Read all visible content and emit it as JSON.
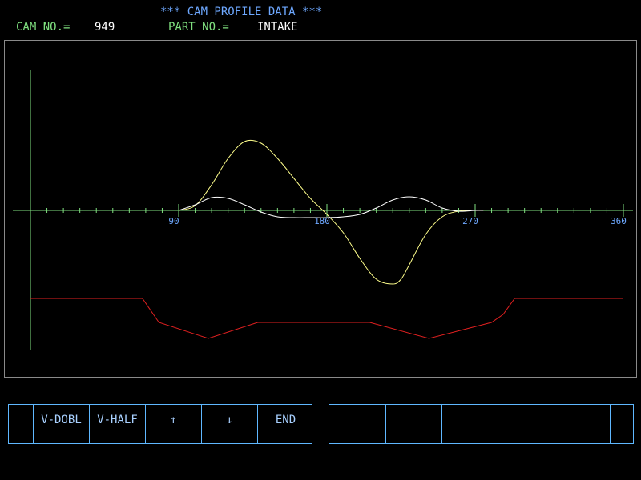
{
  "header": {
    "title": "*** CAM PROFILE DATA ***",
    "cam_no_label": "CAM NO.=",
    "cam_no_value": "949",
    "part_no_label": "PART NO.=",
    "part_no_value": "INTAKE"
  },
  "chart_data": {
    "type": "line",
    "x_range": [
      0,
      360
    ],
    "x_tick_labels": [
      "90",
      "180",
      "270",
      "360"
    ],
    "x_tick_values": [
      90,
      180,
      270,
      360
    ],
    "series": [
      {
        "color": "#ffff8c",
        "x": [
          90,
          100,
          110,
          120,
          130,
          140,
          150,
          160,
          170,
          180,
          190,
          200,
          210,
          220,
          225,
          230,
          240,
          250,
          260,
          270,
          275
        ],
        "y": [
          0,
          0.06,
          0.32,
          0.65,
          0.86,
          0.84,
          0.65,
          0.4,
          0.15,
          -0.05,
          -0.28,
          -0.6,
          -0.86,
          -0.92,
          -0.86,
          -0.68,
          -0.3,
          -0.08,
          -0.01,
          0,
          0
        ]
      },
      {
        "color": "#ffffff",
        "x": [
          90,
          100,
          110,
          120,
          130,
          140,
          150,
          160,
          170,
          180,
          190,
          200,
          210,
          220,
          230,
          240,
          250,
          260,
          270,
          275
        ],
        "y": [
          0,
          0.07,
          0.16,
          0.15,
          0.07,
          -0.02,
          -0.08,
          -0.09,
          -0.09,
          -0.09,
          -0.08,
          -0.05,
          0.03,
          0.13,
          0.17,
          0.13,
          0.03,
          -0.01,
          0,
          0
        ]
      },
      {
        "color": "#e02020",
        "x": [
          0,
          68,
          78,
          108,
          138,
          206,
          242,
          280,
          287,
          294,
          360
        ],
        "y": [
          -1.1,
          -1.1,
          -1.4,
          -1.6,
          -1.4,
          -1.4,
          -1.6,
          -1.4,
          -1.3,
          -1.1,
          -1.1
        ]
      }
    ]
  },
  "fkeys_left": [
    "",
    "V-DOBL",
    "V-HALF",
    "↑",
    "↓",
    "END"
  ],
  "fkeys_right": [
    "",
    "",
    "",
    "",
    "",
    ""
  ]
}
